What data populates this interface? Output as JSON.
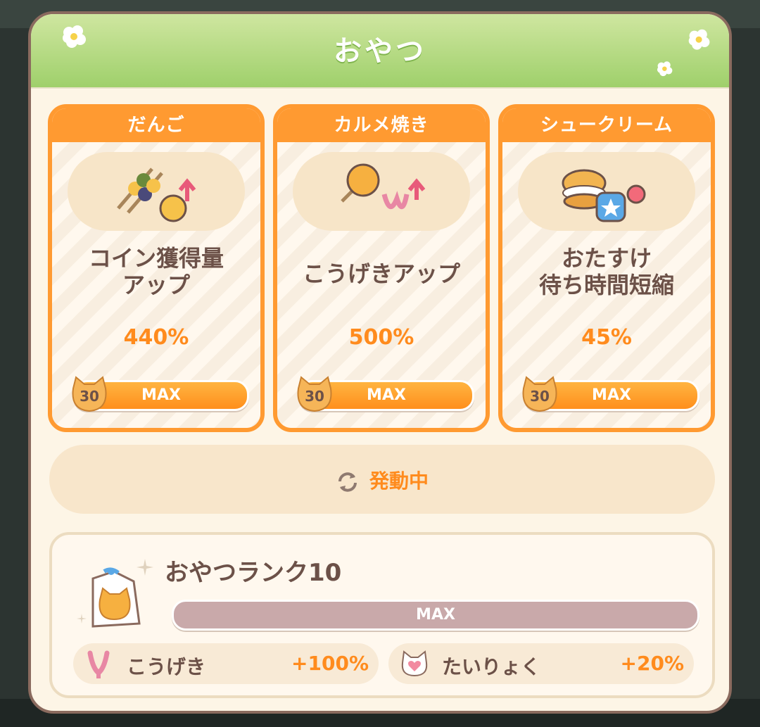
{
  "modal": {
    "title": "おやつ"
  },
  "snacks": [
    {
      "name": "だんご",
      "effect_lines": [
        "コイン獲得量",
        "アップ"
      ],
      "value": "440%",
      "level": "30",
      "status": "MAX",
      "icon": "dango-coin-up-icon"
    },
    {
      "name": "カルメ焼き",
      "effect_lines": [
        "こうげきアップ",
        ""
      ],
      "value": "500%",
      "level": "30",
      "status": "MAX",
      "icon": "karume-attack-up-icon"
    },
    {
      "name": "シュークリーム",
      "effect_lines": [
        "おたすけ",
        "待ち時間短縮"
      ],
      "value": "45%",
      "level": "30",
      "status": "MAX",
      "icon": "cream-puff-helper-icon"
    }
  ],
  "active_button": {
    "label": "発動中",
    "icon": "refresh-icon"
  },
  "rank": {
    "title": "おやつランク10",
    "progress_label": "MAX",
    "icon": "snack-bag-icon"
  },
  "stats": [
    {
      "label": "こうげき",
      "value": "+100%",
      "icon": "claw-icon"
    },
    {
      "label": "たいりょく",
      "value": "+20%",
      "icon": "heart-icon"
    }
  ],
  "colors": {
    "accent_orange": "#ff9a31",
    "header_green": "#9fd06b",
    "text_brown": "#6c5148",
    "rank_bar": "#c9a9aa"
  }
}
